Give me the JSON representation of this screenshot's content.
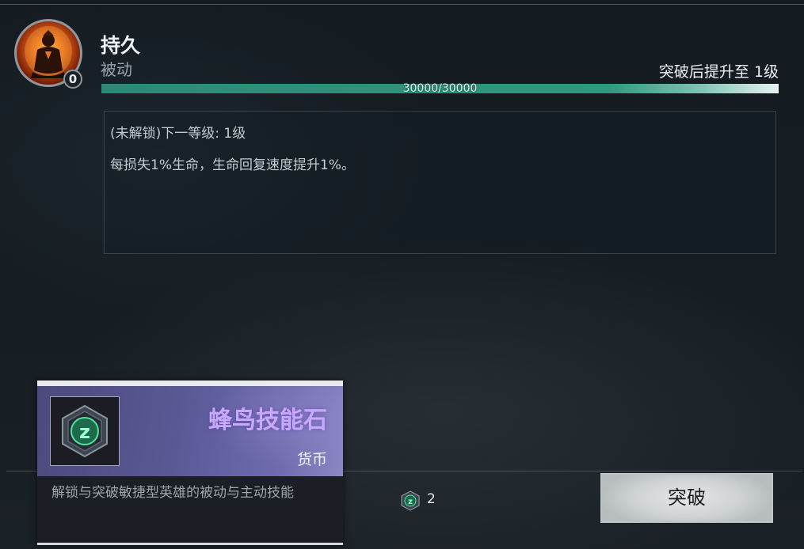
{
  "skill": {
    "name": "持久",
    "type": "被动",
    "level_badge": "0",
    "icon": "meditating-warrior-portrait",
    "breakthrough_target": "突破后提升至 1级"
  },
  "progress": {
    "current": 30000,
    "max": 30000,
    "fraction": 1.0,
    "label": "30000/30000"
  },
  "description": {
    "next_level": "(未解锁)下一等级: 1级",
    "effect": "每损失1%生命，生命回复速度提升1%。"
  },
  "tooltip": {
    "item_name": "蜂鸟技能石",
    "item_type": "货币",
    "icon": "hummingbird-skill-stone-icon",
    "description": "解锁与突破敏捷型英雄的被动与主动技能"
  },
  "cost": {
    "icon": "skill-stone-icon",
    "amount": "2"
  },
  "actions": {
    "breakthrough_label": "突破"
  },
  "colors": {
    "progress": "#2f9880",
    "item_name": "#c9a8ff"
  }
}
